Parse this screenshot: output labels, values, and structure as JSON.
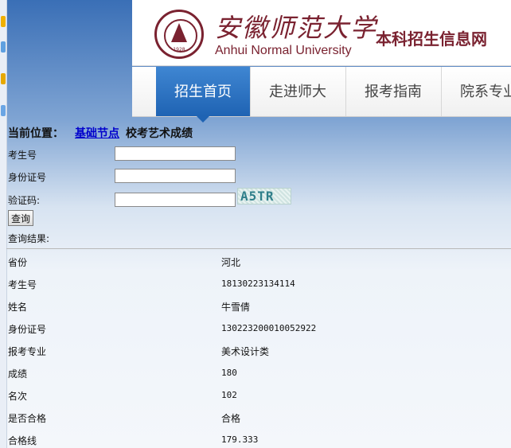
{
  "header": {
    "cn_name": "安徽师范大学",
    "en_name": "Anhui Normal University",
    "site_title": "本科招生信息网",
    "seal_year": "1928"
  },
  "nav": {
    "items": [
      {
        "label": "招生首页",
        "active": true
      },
      {
        "label": "走进师大",
        "active": false
      },
      {
        "label": "报考指南",
        "active": false
      },
      {
        "label": "院系专业",
        "active": false
      }
    ]
  },
  "breadcrumb": {
    "prefix": "当前位置：",
    "link": "基础节点",
    "current": "校考艺术成绩"
  },
  "form": {
    "exam_no_label": "考生号",
    "exam_no_value": "",
    "id_label": "身份证号",
    "id_value": "",
    "captcha_label": "验证码:",
    "captcha_value": "",
    "captcha_text": "A5TR",
    "query_button": "查询"
  },
  "results": {
    "title": "查询结果:",
    "rows": [
      {
        "label": "省份",
        "value": "河北"
      },
      {
        "label": "考生号",
        "value": "18130223134114"
      },
      {
        "label": "姓名",
        "value": "牛雪倩"
      },
      {
        "label": "身份证号",
        "value": "130223200010052922"
      },
      {
        "label": "报考专业",
        "value": "美术设计类"
      },
      {
        "label": "成绩",
        "value": "180"
      },
      {
        "label": "名次",
        "value": "102"
      },
      {
        "label": "是否合格",
        "value": "合格"
      },
      {
        "label": "合格线",
        "value": "179.333"
      }
    ]
  },
  "colors": {
    "brand": "#7a2230",
    "nav_active": "#1f63b3",
    "link": "#0000cc"
  }
}
